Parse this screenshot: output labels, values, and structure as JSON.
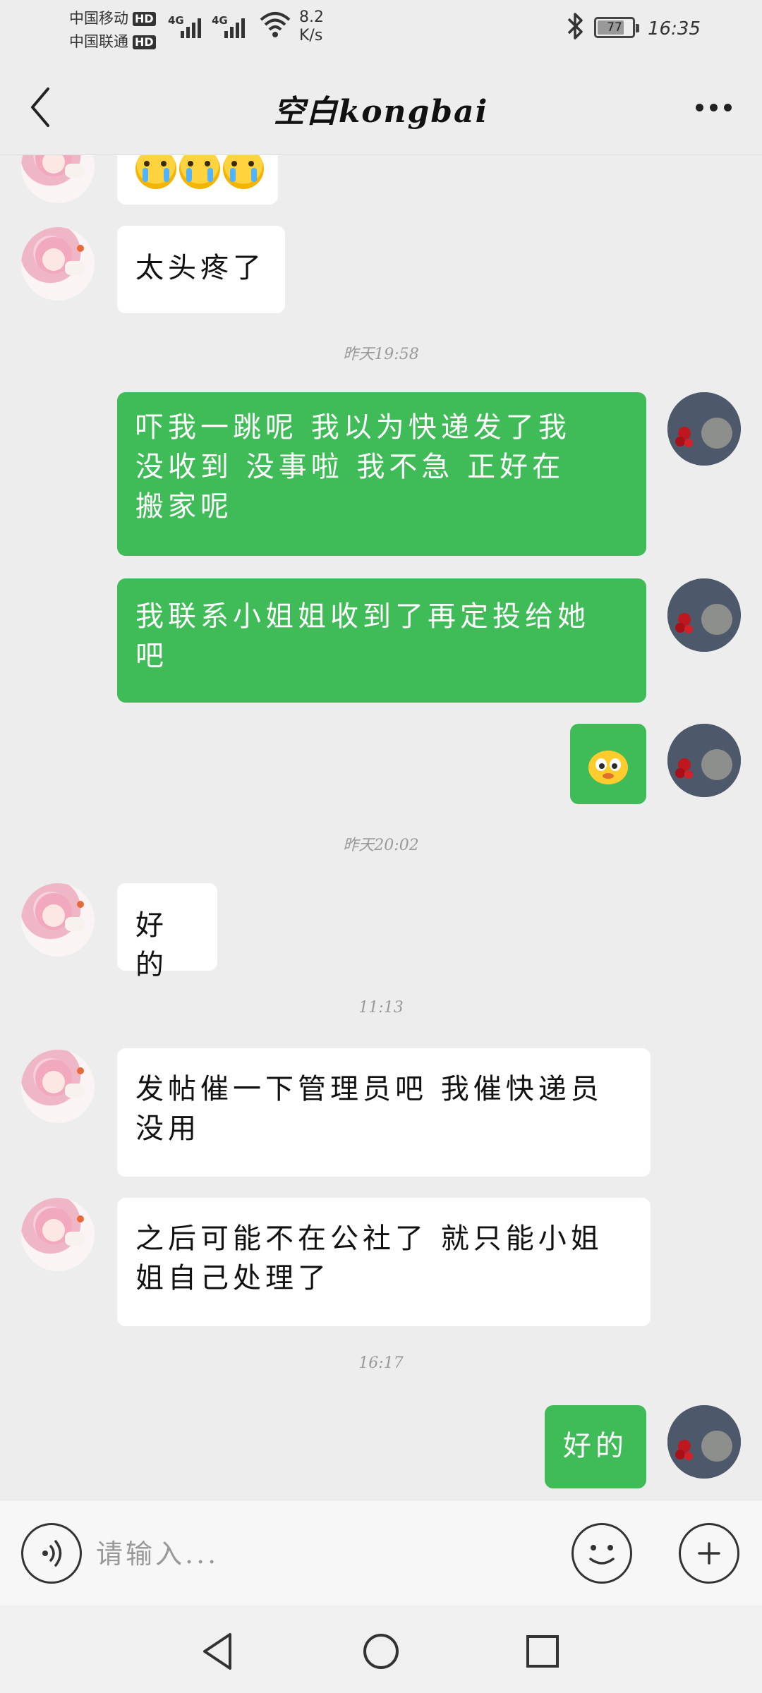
{
  "status_bar": {
    "carrier_1": "中国移动",
    "carrier_2": "中国联通",
    "hd_1": "HD",
    "hd_2": "HD",
    "network_1": "4G",
    "network_2": "4G",
    "speed_value": "8.2",
    "speed_unit": "K/s",
    "battery_level": "77",
    "battery_fraction": 0.77,
    "time": "16:35",
    "icons": [
      "signal-icon",
      "wifi-icon",
      "bluetooth-icon",
      "battery-icon"
    ]
  },
  "header": {
    "title": "空白kongbai",
    "back_icon": "chevron-left-icon",
    "more_icon": "more-icon"
  },
  "colors": {
    "background": "#ededed",
    "self_bubble": "#3fbb57",
    "other_bubble": "#ffffff",
    "timestamp": "#9a9a9a"
  },
  "messages": [
    {
      "sender": "other",
      "type": "emoji",
      "content": "😭😭😭"
    },
    {
      "sender": "other",
      "type": "text",
      "lines": [
        "太头疼了"
      ]
    },
    {
      "type": "time",
      "content": "昨天19:58"
    },
    {
      "sender": "self",
      "type": "text",
      "lines": [
        "吓我一跳呢  我以为快递发了我",
        "没收到  没事啦  我不急  正好在",
        "搬家呢"
      ]
    },
    {
      "sender": "self",
      "type": "text",
      "lines": [
        "我联系小姐姐收到了再定投给她",
        "吧"
      ]
    },
    {
      "sender": "self",
      "type": "sticker",
      "content": "sticker"
    },
    {
      "type": "time",
      "content": "昨天20:02"
    },
    {
      "sender": "other",
      "type": "text",
      "lines": [
        "好的"
      ]
    },
    {
      "type": "time",
      "content": "11:13"
    },
    {
      "sender": "other",
      "type": "text",
      "lines": [
        "发帖催一下管理员吧 我催快递员",
        "没用"
      ]
    },
    {
      "sender": "other",
      "type": "text",
      "lines": [
        "之后可能不在公社了 就只能小姐",
        "姐自己处理了"
      ]
    },
    {
      "type": "time",
      "content": "16:17"
    },
    {
      "sender": "self",
      "type": "text",
      "lines": [
        "好的"
      ]
    }
  ],
  "input_bar": {
    "placeholder": "请输入...",
    "voice_icon": "voice-icon",
    "emoji_icon": "smiley-icon",
    "plus_icon": "plus-icon"
  },
  "nav_bar": {
    "icons": [
      "back-triangle-icon",
      "home-circle-icon",
      "recents-square-icon"
    ]
  }
}
